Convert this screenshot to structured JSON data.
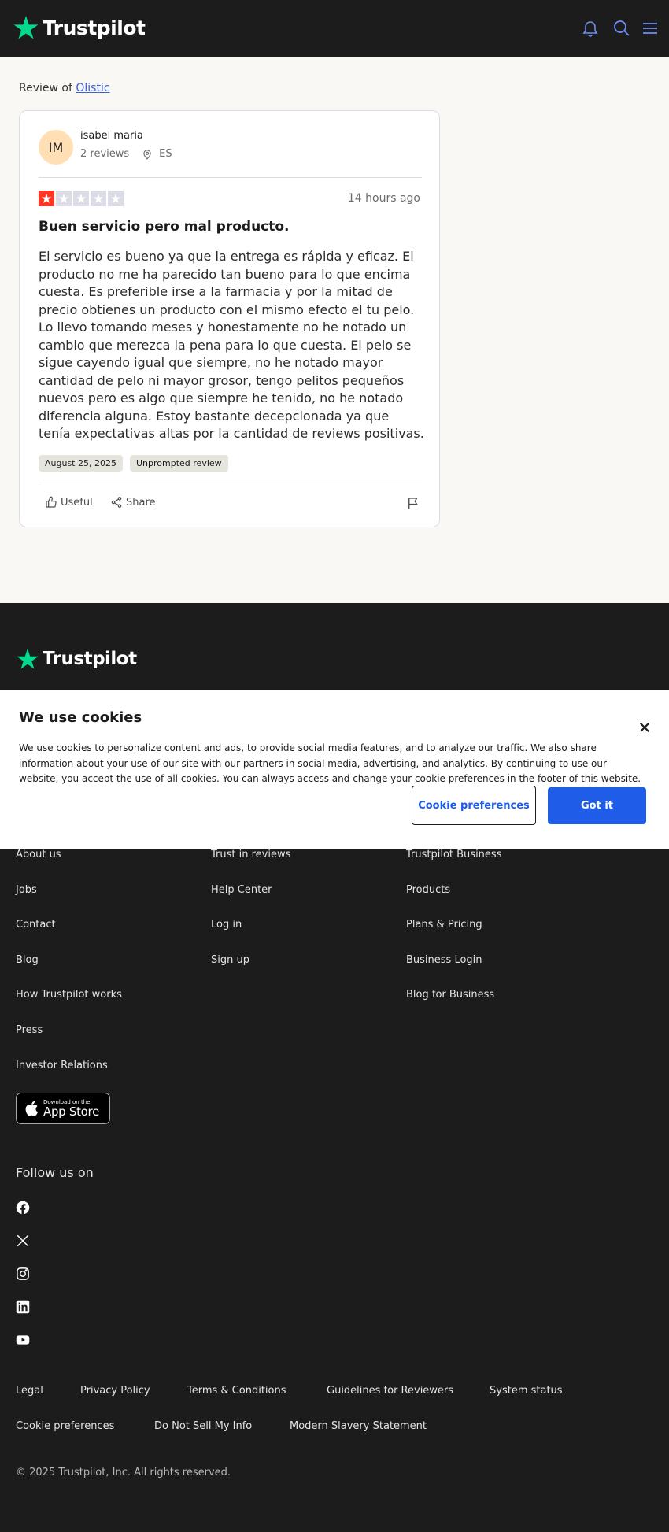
{
  "header": {
    "brand": "Trustpilot",
    "icons": [
      "bell-icon",
      "search-icon",
      "menu-icon"
    ]
  },
  "review_of": {
    "prefix": "Review of",
    "company": "Olistic"
  },
  "review": {
    "reviewer": {
      "initials": "IM",
      "name": "isabel maria",
      "review_count": "2 reviews",
      "country": "ES"
    },
    "rating": 1,
    "rating_max": 5,
    "time_ago": "14 hours ago",
    "title": "Buen servicio pero mal producto.",
    "body": "El servicio es bueno ya que la entrega es rápida y eficaz. El producto no me ha parecido tan bueno para lo que encima cuesta. Es preferible irse a la farmacia y por la mitad de precio obtienes un producto con el mismo efecto el tu pelo. Lo llevo tomando meses y honestamente no he notado un cambio que merezca la pena para lo que cuesta. El pelo se sigue cayendo igual que siempre, no he notado mayor cantidad de pelo ni mayor grosor, tengo pelitos pequeños nuevos pero es algo que siempre he tenido, no he notado diferencia alguna. Estoy bastante decepcionada ya que tenía expectativas altas por la cantidad de reviews positivas.",
    "date_tag": "August 25, 2025",
    "type_tag": "Unprompted review",
    "actions": {
      "useful": "Useful",
      "share": "Share"
    }
  },
  "colors": {
    "rating_red": "#ff3722",
    "star_empty": "#dcdce6",
    "brand_green": "#04da8d",
    "header_icon_blue": "#6e8ef7",
    "primary_button": "#1f5de8"
  },
  "footer": {
    "brand": "Trustpilot",
    "col1": [
      "About us",
      "Jobs",
      "Contact",
      "Blog",
      "How Trustpilot works",
      "Press",
      "Investor Relations"
    ],
    "col2": [
      "Trust in reviews",
      "Help Center",
      "Log in",
      "Sign up"
    ],
    "col3": [
      "Trustpilot Business",
      "Products",
      "Plans & Pricing",
      "Business Login",
      "Blog for Business"
    ],
    "app_store": {
      "small": "Download on the",
      "big": "App Store"
    },
    "follow_label": "Follow us on",
    "social": [
      "facebook-icon",
      "x-icon",
      "instagram-icon",
      "linkedin-icon",
      "youtube-icon"
    ],
    "legal_row1": [
      "Legal",
      "Privacy Policy",
      "Terms & Conditions",
      "Guidelines for Reviewers",
      "System status"
    ],
    "legal_row2": [
      "Cookie preferences",
      "Do Not Sell My Info",
      "Modern Slavery Statement"
    ],
    "copyright": "© 2025 Trustpilot, Inc. All rights reserved."
  },
  "cookie_banner": {
    "title": "We use cookies",
    "text": "We use cookies to personalize content and ads, to provide social media features, and to analyze our traffic. We also share information about your use of our site with our partners in social media, advertising, and analytics. By continuing to use our website, you accept the use of all cookies. You can always access and change your cookie preferences in the footer of this website.",
    "prefs_button": "Cookie preferences",
    "accept_button": "Got it"
  }
}
